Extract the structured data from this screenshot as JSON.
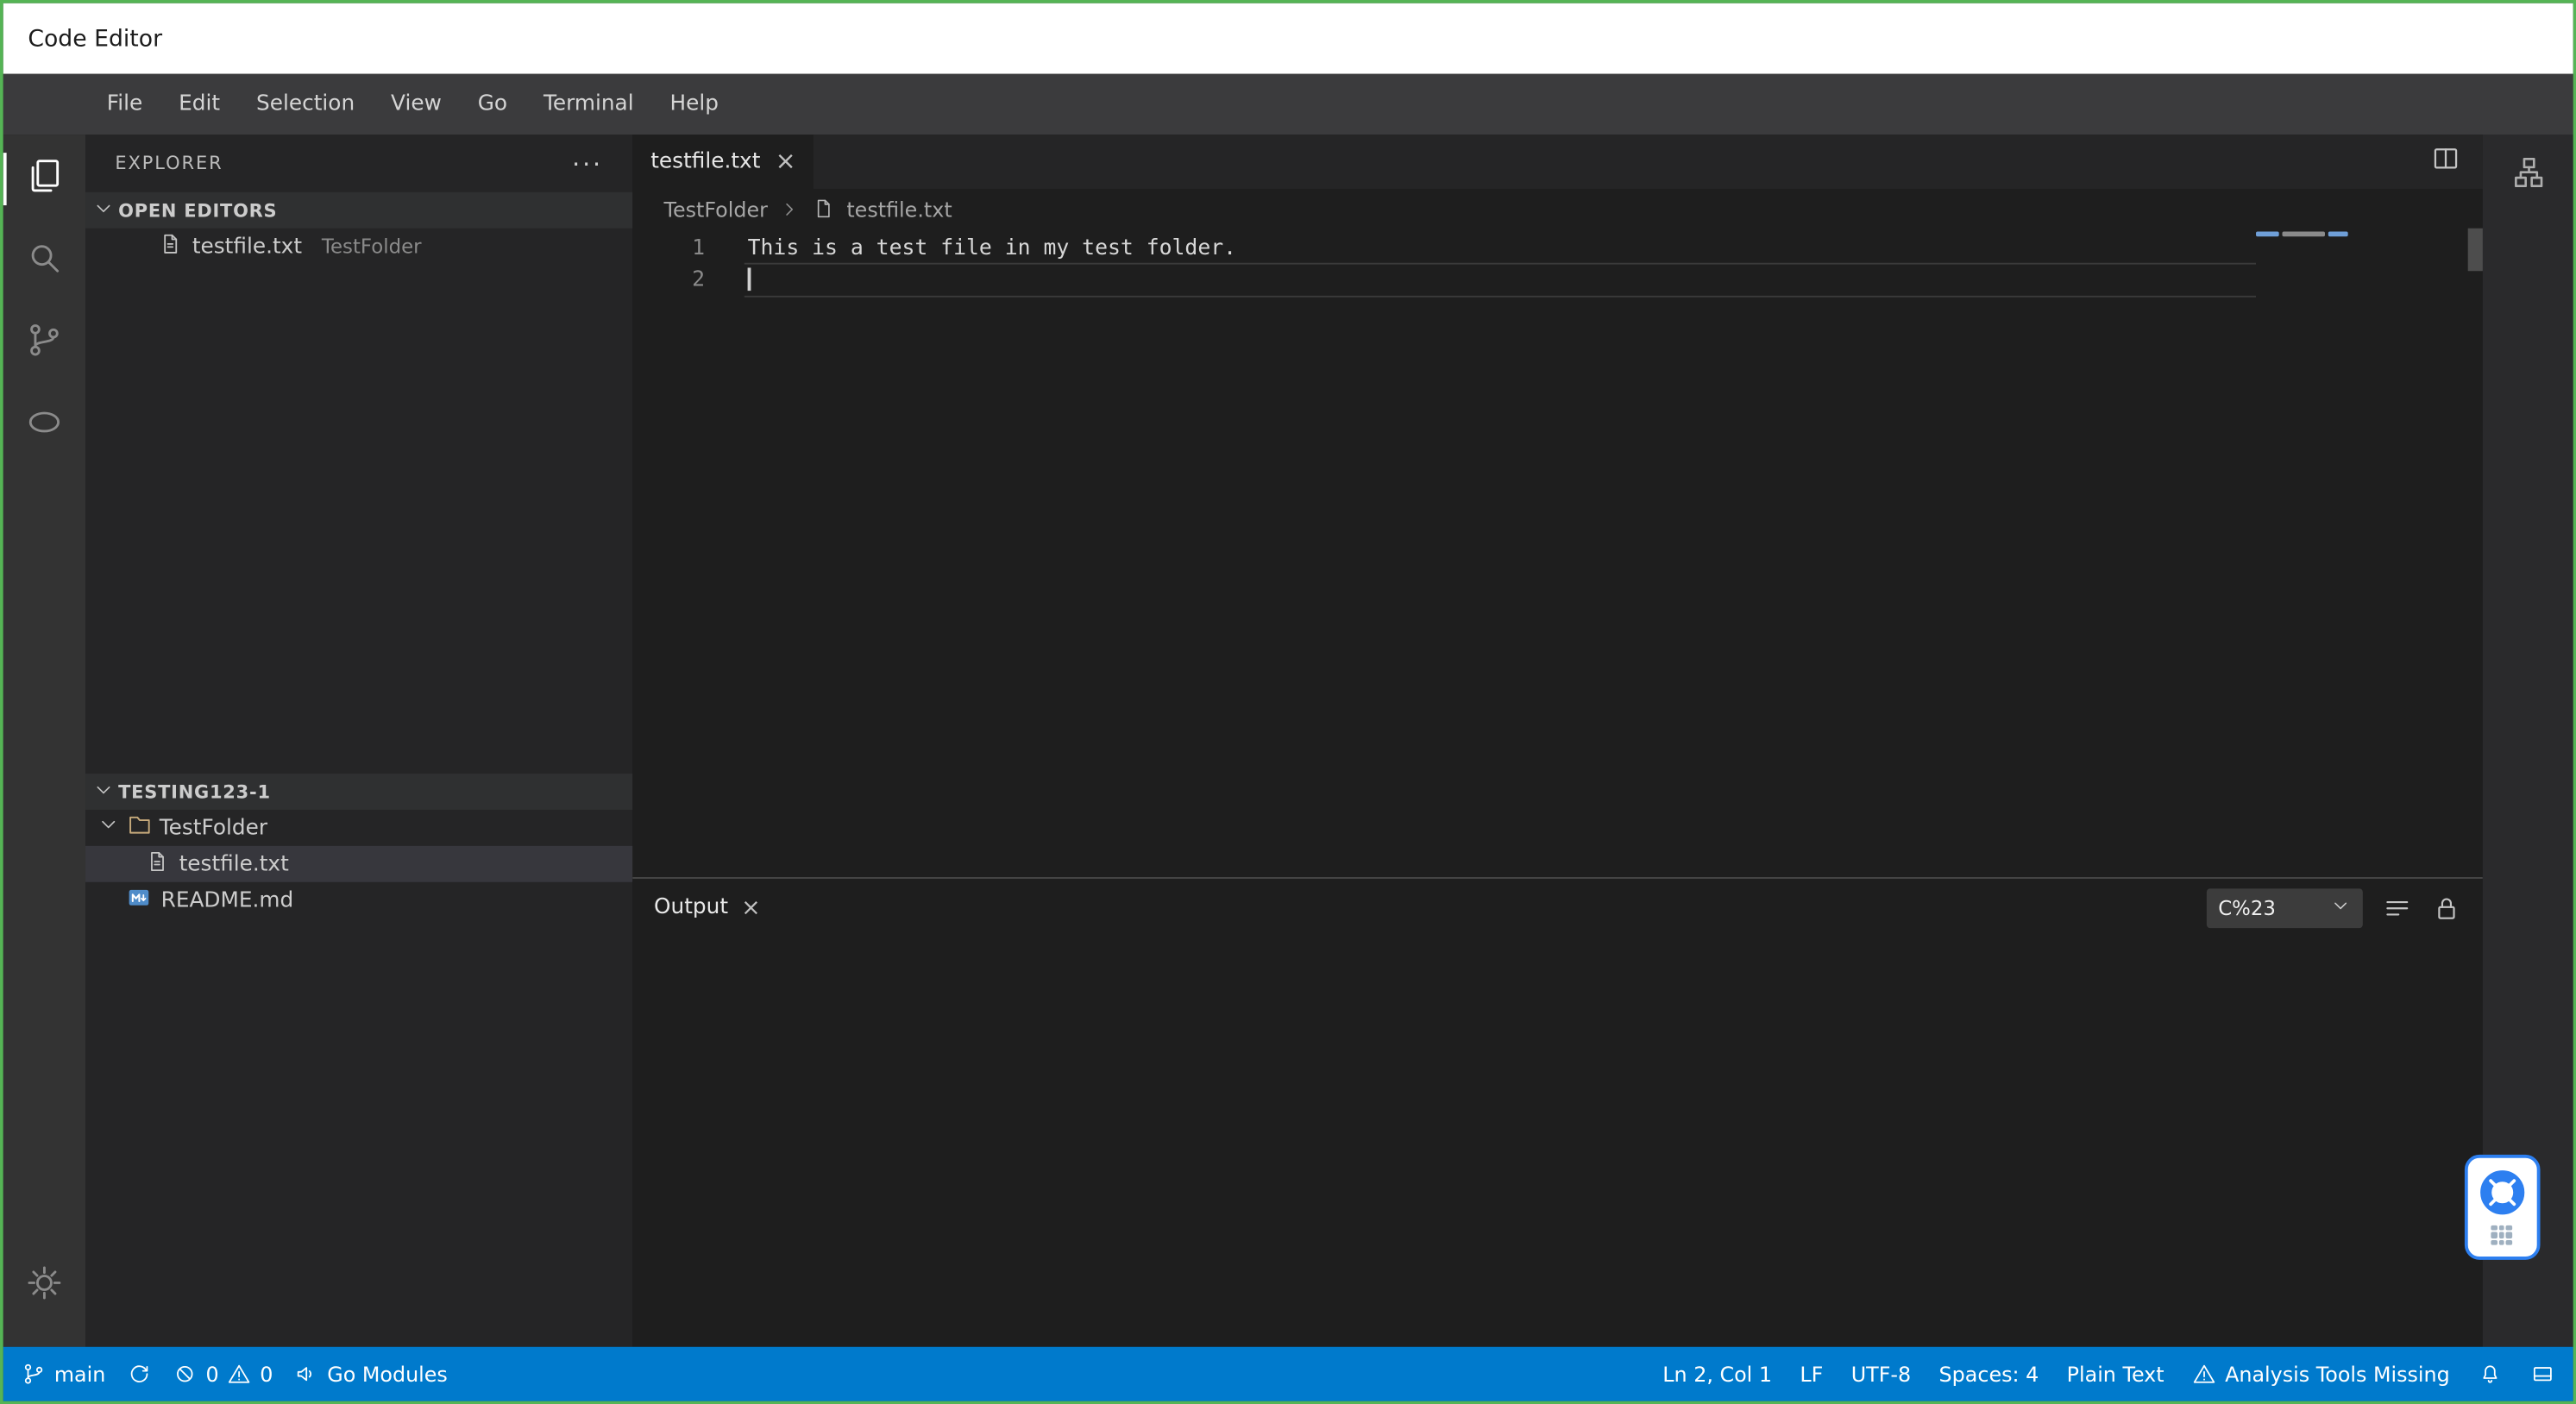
{
  "window": {
    "title": "Code Editor"
  },
  "menu_bar": {
    "items": [
      "File",
      "Edit",
      "Selection",
      "View",
      "Go",
      "Terminal",
      "Help"
    ]
  },
  "glyphs": {
    "close": "×",
    "more": "···"
  },
  "icons": {
    "activity_bar": [
      "files-icon",
      "search-icon",
      "source-control-icon",
      "run-oval-icon",
      "settings-gear-icon"
    ],
    "editor_actions": [
      "split-editor-icon"
    ],
    "panel_actions": [
      "word-wrap-icon",
      "lock-icon"
    ],
    "status_left": [
      "git-branch-icon",
      "sync-icon",
      "error-icon",
      "warning-icon",
      "speaker-icon"
    ],
    "status_right": [
      "warning-icon",
      "bell-icon",
      "panel-layout-icon"
    ],
    "right_strip": [
      "layout-icon"
    ],
    "widget": [
      "life-buoy-icon",
      "drag-dots"
    ]
  },
  "sidebar": {
    "title": "EXPLORER",
    "open_editors": {
      "label": "OPEN EDITORS",
      "items": [
        {
          "file": "testfile.txt",
          "detail": "TestFolder"
        }
      ]
    },
    "workspace": {
      "label": "TESTING123-1",
      "tree": [
        {
          "name": "TestFolder",
          "type": "folder",
          "expanded": true
        },
        {
          "name": "testfile.txt",
          "type": "file",
          "selected": true,
          "parent": "TestFolder"
        },
        {
          "name": "README.md",
          "type": "markdown",
          "selected": false
        }
      ]
    }
  },
  "editor": {
    "tabs": [
      {
        "label": "testfile.txt",
        "active": true
      }
    ],
    "breadcrumbs": {
      "folder": "TestFolder",
      "file": "testfile.txt"
    },
    "code": {
      "lines": [
        {
          "number": "1",
          "text": "This is a test file in my test folder."
        },
        {
          "number": "2",
          "text": ""
        }
      ],
      "cursor": {
        "line": 2,
        "col": 1
      }
    }
  },
  "panel": {
    "tabs": [
      {
        "label": "Output",
        "active": true
      }
    ],
    "channel_select": {
      "value": "C%23"
    }
  },
  "status_bar": {
    "left": {
      "branch": "main",
      "errors": "0",
      "warnings": "0",
      "go_modules": "Go Modules"
    },
    "right": {
      "cursor_position": "Ln 2, Col 1",
      "eol": "LF",
      "encoding": "UTF-8",
      "indentation": "Spaces: 4",
      "language": "Plain Text",
      "analysis_warning": "Analysis Tools Missing"
    }
  },
  "colors": {
    "frame": "#55b455",
    "status_bar": "#007acc",
    "editor_background": "#1e1e1e",
    "sidebar_background": "#252526",
    "activity_bar_background": "#333333",
    "selected_row": "#37373d",
    "titlebar_background": "#ffffff"
  }
}
